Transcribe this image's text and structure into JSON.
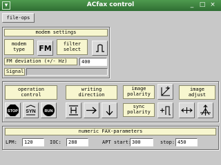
{
  "window": {
    "title": "ACfax control"
  },
  "toolbar": {
    "file_ops": "file-ops"
  },
  "modem": {
    "section_title": "modem settings",
    "type_label": "modem\ntype",
    "fm_button": "FM",
    "filter_label": "filter\nselect",
    "deviation_label": "FM deviation (+/- Hz)",
    "deviation_value": "400",
    "signal_label": "Signal"
  },
  "controls": {
    "operation_label": "operation\ncontrol",
    "writing_label": "writing\ndirection",
    "image_polarity_label": "image\npolarity",
    "sync_polarity_label": "sync\npolarity",
    "image_adjust_label": "image\nadjust",
    "stop_label": "STOP",
    "syn_label": "SYN",
    "run_label": "RUN"
  },
  "params": {
    "section_title": "numeric FAX-parameters",
    "lpm_label": "LPM:",
    "lpm_value": "120",
    "ioc_label": "IOC:",
    "ioc_value": "288",
    "apt_start_label": "APT start:",
    "apt_start_value": "300",
    "stop_label": "stop:",
    "stop_value": "450"
  }
}
